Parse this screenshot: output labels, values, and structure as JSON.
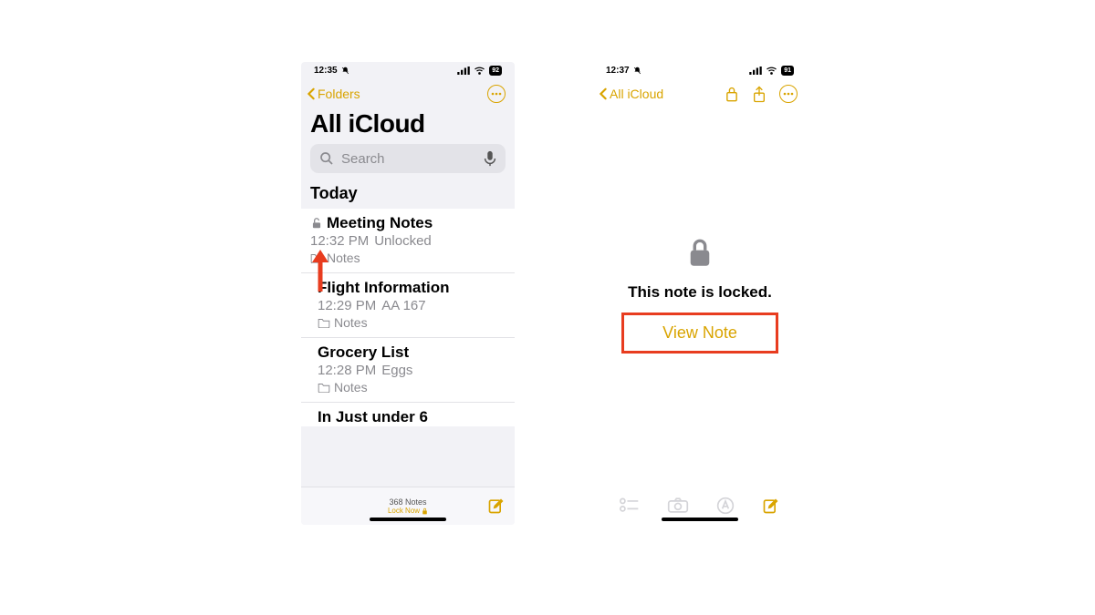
{
  "left": {
    "status": {
      "time": "12:35",
      "battery": "92"
    },
    "nav": {
      "back": "Folders"
    },
    "title": "All iCloud",
    "search_placeholder": "Search",
    "section": "Today",
    "notes": [
      {
        "title": "Meeting Notes",
        "time": "12:32 PM",
        "preview": "Unlocked",
        "folder": "Notes",
        "locked": true
      },
      {
        "title": "Flight Information",
        "time": "12:29 PM",
        "preview": "AA 167",
        "folder": "Notes",
        "locked": false
      },
      {
        "title": "Grocery List",
        "time": "12:28 PM",
        "preview": "Eggs",
        "folder": "Notes",
        "locked": false
      }
    ],
    "cutoff_title": "In Just under 6",
    "footer": {
      "count": "368 Notes",
      "lock_now": "Lock Now"
    }
  },
  "right": {
    "status": {
      "time": "12:37",
      "battery": "91"
    },
    "nav": {
      "back": "All iCloud"
    },
    "locked_message": "This note is locked.",
    "view_button": "View Note"
  },
  "colors": {
    "accent": "#d9a400",
    "annotation": "#e83c1f"
  }
}
